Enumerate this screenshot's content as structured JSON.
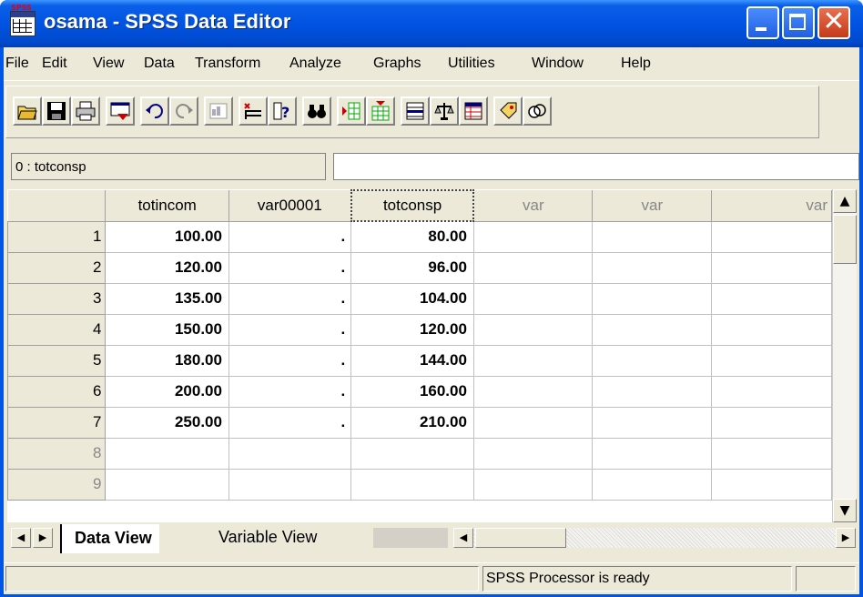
{
  "window": {
    "title": "osama - SPSS Data Editor",
    "icon_label": "SPSS"
  },
  "menu": [
    "File",
    "Edit",
    "View",
    "Data",
    "Transform",
    "Analyze",
    "Graphs",
    "Utilities",
    "Window",
    "Help"
  ],
  "toolbar": {
    "icons": [
      "open-folder-icon",
      "save-disk-icon",
      "print-icon",
      "dialog-recall-icon",
      "undo-icon",
      "redo-icon",
      "goto-chart-icon",
      "goto-case-icon",
      "variables-info-icon",
      "find-binoculars-icon",
      "insert-case-icon",
      "insert-variable-icon",
      "split-file-icon",
      "weight-cases-icon",
      "select-cases-icon",
      "value-labels-icon",
      "use-sets-icon"
    ]
  },
  "cell_editor": {
    "name": "0 : totconsp",
    "value": ""
  },
  "grid": {
    "columns": [
      "totincom",
      "var00001",
      "totconsp",
      "var",
      "var",
      "var"
    ],
    "rows": [
      {
        "n": "1",
        "totincom": "100.00",
        "var00001": ".",
        "totconsp": "80.00"
      },
      {
        "n": "2",
        "totincom": "120.00",
        "var00001": ".",
        "totconsp": "96.00"
      },
      {
        "n": "3",
        "totincom": "135.00",
        "var00001": ".",
        "totconsp": "104.00"
      },
      {
        "n": "4",
        "totincom": "150.00",
        "var00001": ".",
        "totconsp": "120.00"
      },
      {
        "n": "5",
        "totincom": "180.00",
        "var00001": ".",
        "totconsp": "144.00"
      },
      {
        "n": "6",
        "totincom": "200.00",
        "var00001": ".",
        "totconsp": "160.00"
      },
      {
        "n": "7",
        "totincom": "250.00",
        "var00001": ".",
        "totconsp": "210.00"
      },
      {
        "n": "8",
        "totincom": "",
        "var00001": "",
        "totconsp": ""
      },
      {
        "n": "9",
        "totincom": "",
        "var00001": "",
        "totconsp": ""
      }
    ]
  },
  "tabs": {
    "data_view": "Data View",
    "variable_view": "Variable View"
  },
  "status": {
    "processor": "SPSS Processor  is ready"
  }
}
